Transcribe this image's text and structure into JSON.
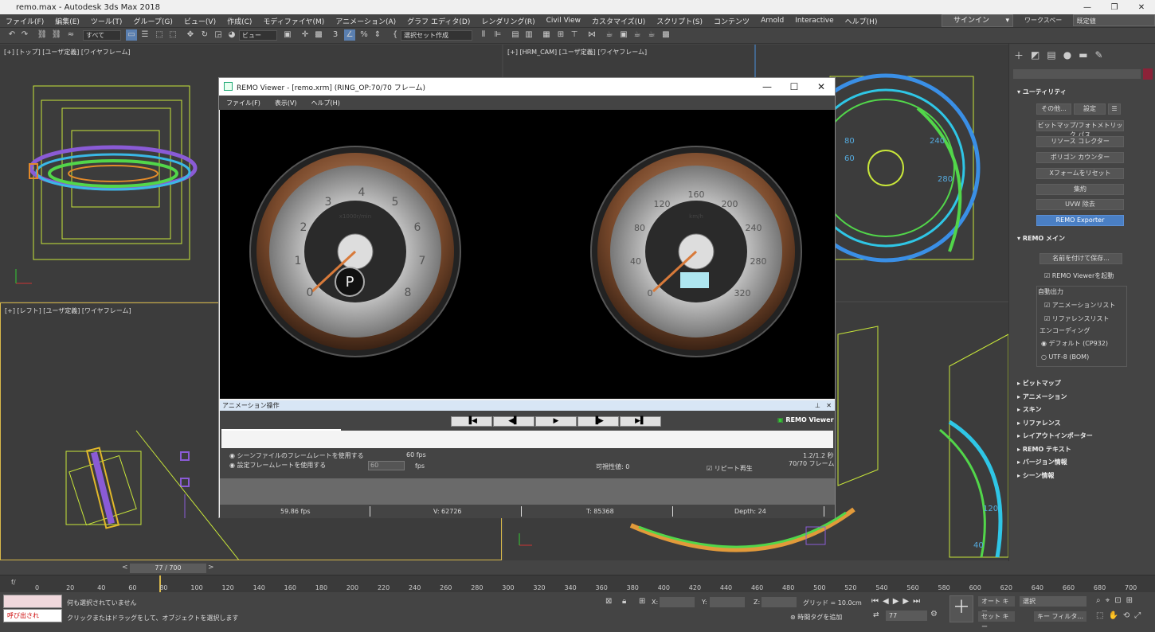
{
  "window": {
    "title": "remo.max - Autodesk 3ds Max 2018"
  },
  "menu": [
    "ファイル(F)",
    "編集(E)",
    "ツール(T)",
    "グループ(G)",
    "ビュー(V)",
    "作成(C)",
    "モディファイヤ(M)",
    "アニメーション(A)",
    "グラフ エディタ(D)",
    "レンダリング(R)",
    "Civil View",
    "カスタマイズ(U)",
    "スクリプト(S)",
    "コンテンツ",
    "Arnold",
    "Interactive",
    "ヘルプ(H)"
  ],
  "signin": "サインイン",
  "workspace": {
    "label": "ワークスペース:",
    "value": "既定値"
  },
  "toolbar": {
    "filter": "すべて",
    "view": "ビュー",
    "selset": "選択セット作成"
  },
  "viewports": {
    "top": "[+] [トップ] [ユーザ定義] [ワイヤフレーム]",
    "cam": "[+] [HRM_CAM] [ユーザ定義] [ワイヤフレーム]",
    "left": "[+] [レフト] [ユーザ定義] [ワイヤフレーム]"
  },
  "remo": {
    "title": "REMO Viewer - [remo.xrm] (RING_OP:70/70 フレーム)",
    "menu": [
      "ファイル(F)",
      "表示(V)",
      "ヘルプ(H)"
    ],
    "gauge_left": {
      "ticks": [
        "0",
        "1",
        "2",
        "3",
        "4",
        "5",
        "6",
        "7",
        "8"
      ],
      "unit": "x1000r/min",
      "gear": "P"
    },
    "gauge_right": {
      "ticks": [
        "0",
        "40",
        "80",
        "120",
        "160",
        "200",
        "240",
        "280",
        "320"
      ],
      "unit": "km/h"
    }
  },
  "anim": {
    "title": "アニメーション操作",
    "brand": "REMO Viewer",
    "use_scene": "シーンファイルのフレームレートを使用する",
    "use_set": "設定フレームレートを使用する",
    "scene_fps": "60 fps",
    "set_fps_value": "60",
    "fps": "fps",
    "visible": "可視性値: 0",
    "time": "1.2/1.2 秒",
    "frames": "70/70 フレーム",
    "repeat": "リピート再生",
    "fps_actual": "59.86 fps",
    "verts": "V: 62726",
    "tris": "T: 85368",
    "depth": "Depth: 24"
  },
  "cmd": {
    "utility": "ユーティリティ",
    "other": "その他...",
    "settings": "設定",
    "buttons": [
      "ビットマップ/フォトメトリック パス",
      "リソース コレクター",
      "ポリゴン カウンター",
      "Xフォームをリセット",
      "集約",
      "UVW 除去",
      "REMO Exporter"
    ],
    "remo_main": "REMO メイン",
    "save_as": "名前を付けて保存...",
    "launch": "REMO Viewerを起動",
    "auto_out": "自動出力",
    "anim_list": "アニメーションリスト",
    "ref_list": "リファレンスリスト",
    "encoding": "エンコーディング",
    "enc_default": "デフォルト (CP932)",
    "enc_utf8": "UTF-8 (BOM)",
    "rollouts": [
      "ビットマップ",
      "アニメーション",
      "スキン",
      "リファレンス",
      "レイアウトインポーター",
      "REMO テキスト",
      "バージョン情報",
      "シーン情報"
    ]
  },
  "timeline": {
    "slider": "77 / 700",
    "ticks": [
      "0",
      "20",
      "40",
      "60",
      "80",
      "100",
      "120",
      "140",
      "160",
      "180",
      "200",
      "220",
      "240",
      "260",
      "280",
      "300",
      "320",
      "340",
      "360",
      "380",
      "400",
      "420",
      "440",
      "460",
      "480",
      "500",
      "520",
      "540",
      "560",
      "580",
      "600",
      "620",
      "640",
      "660",
      "680",
      "700"
    ]
  },
  "status": {
    "maxscript": "呼び出され",
    "none_selected": "何も選択されていません",
    "prompt": "クリックまたはドラッグをして、オブジェクトを選択します",
    "x": "X:",
    "y": "Y:",
    "z": "Z:",
    "grid": "グリッド = 10.0cm",
    "add_tag": "時間タグを追加",
    "frame": "77",
    "auto_key": "オート キー",
    "selection": "選択",
    "set_key": "セット キー",
    "key_filter": "キー フィルタ..."
  }
}
